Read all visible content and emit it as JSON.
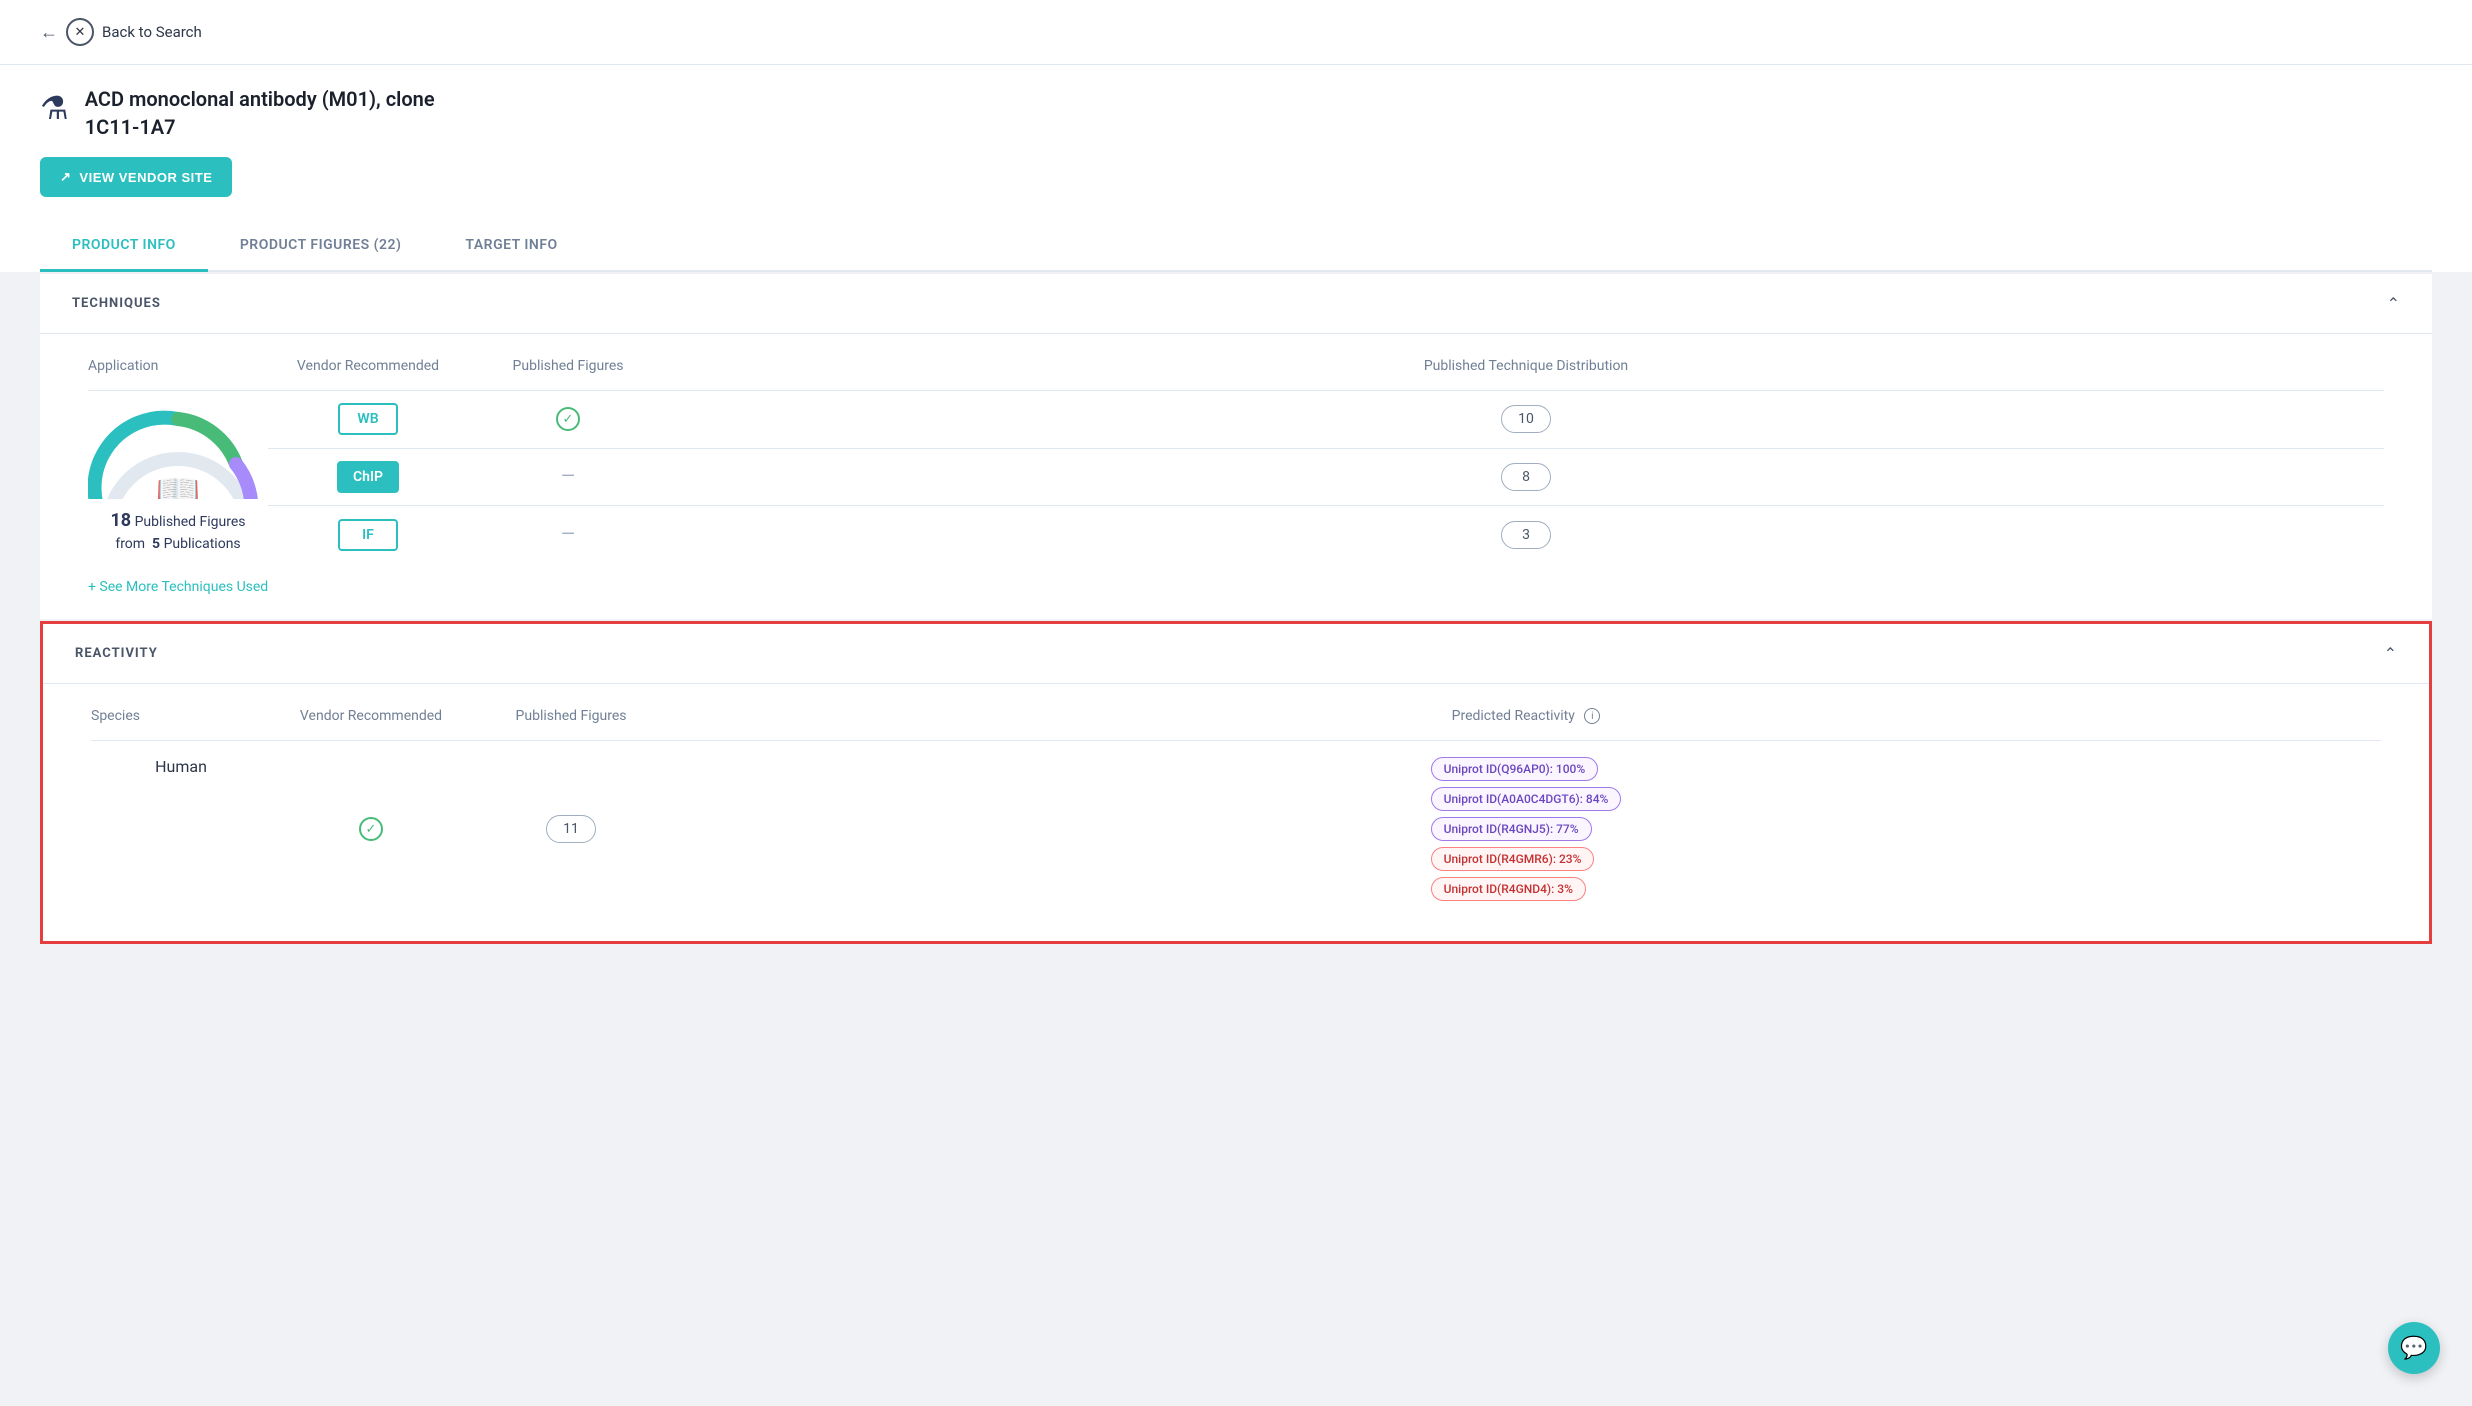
{
  "nav": {
    "back_label": "Back to Search"
  },
  "product": {
    "name_line1": "ACD monoclonal antibody (M01), clone",
    "name_line2": "1C11-1A7",
    "vendor_btn_label": "VIEW VENDOR SITE"
  },
  "tabs": [
    {
      "label": "PRODUCT INFO",
      "active": true
    },
    {
      "label": "PRODUCT FIGURES (22)",
      "active": false
    },
    {
      "label": "TARGET INFO",
      "active": false
    }
  ],
  "techniques_section": {
    "title": "TECHNIQUES",
    "columns": [
      "Application",
      "Vendor Recommended",
      "Published Figures",
      "Published Technique Distribution"
    ],
    "rows": [
      {
        "app": "WB",
        "app_style": "wb",
        "vendor_recommended": true,
        "figures": "10"
      },
      {
        "app": "ChIP",
        "app_style": "chip",
        "vendor_recommended": false,
        "figures": "8"
      },
      {
        "app": "IF",
        "app_style": "if",
        "vendor_recommended": false,
        "figures": "3"
      }
    ],
    "see_more_label": "+ See More Techniques Used",
    "distribution": {
      "count": "18",
      "label": "Published Figures",
      "from_label": "from",
      "pubs_count": "5",
      "pubs_label": "Publications"
    }
  },
  "reactivity_section": {
    "title": "REACTIVITY",
    "columns": [
      "Species",
      "Vendor Recommended",
      "Published Figures",
      "Predicted Reactivity"
    ],
    "rows": [
      {
        "species": "Human",
        "vendor_recommended": true,
        "figures": "11",
        "predicted": [
          {
            "label": "Uniprot ID(Q96AP0): 100%",
            "style": "high"
          },
          {
            "label": "Uniprot ID(A0A0C4DGT6): 84%",
            "style": "high"
          },
          {
            "label": "Uniprot ID(R4GNJ5): 77%",
            "style": "high"
          },
          {
            "label": "Uniprot ID(R4GMR6): 23%",
            "style": "mid"
          },
          {
            "label": "Uniprot ID(R4GND4): 3%",
            "style": "low"
          }
        ]
      }
    ]
  },
  "chat": {
    "icon": "💬"
  }
}
